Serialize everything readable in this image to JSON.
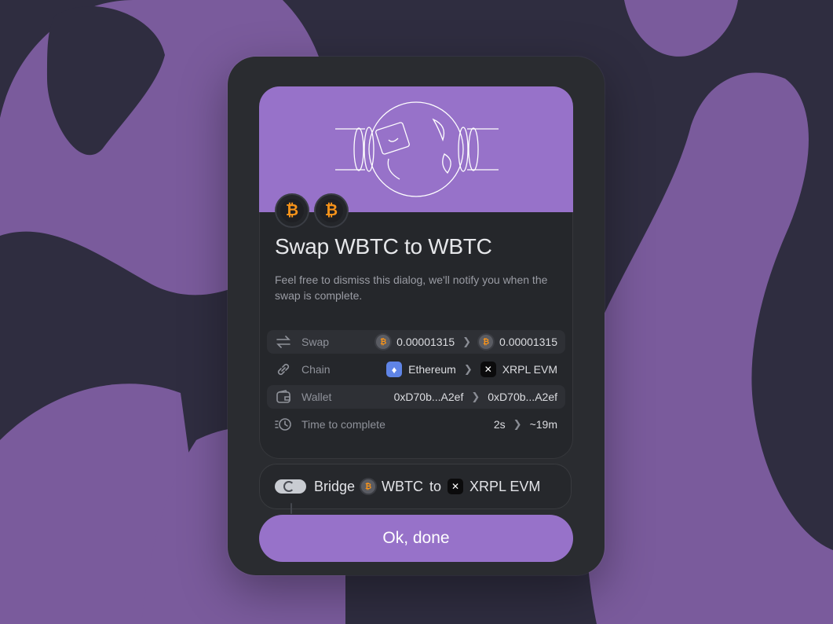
{
  "colors": {
    "background": "#2f2d40",
    "blob": "#7a5b9c",
    "accent": "#9772c9",
    "dialog": "#2a2c30"
  },
  "dialog": {
    "title": "Swap WBTC to WBTC",
    "subtitle": "Feel free to dismiss this dialog, we'll notify you when the swap is complete.",
    "token_from_icon": "bitcoin-icon",
    "token_to_icon": "bitcoin-icon"
  },
  "details": {
    "swap": {
      "label": "Swap",
      "from": "0.00001315",
      "to": "0.00001315",
      "icon": "swap-arrows-icon"
    },
    "chain": {
      "label": "Chain",
      "from": "Ethereum",
      "to": "XRPL EVM",
      "icon": "link-icon"
    },
    "wallet": {
      "label": "Wallet",
      "from": "0xD70b...A2ef",
      "to": "0xD70b...A2ef",
      "icon": "wallet-icon"
    },
    "time": {
      "label": "Time to complete",
      "from": "2s",
      "to": "~19m",
      "icon": "clock-icon"
    },
    "separator": "❯"
  },
  "step": {
    "prefix": "Bridge",
    "token": "WBTC",
    "middle": "to",
    "chain": "XRPL EVM"
  },
  "button": {
    "label": "Ok, done"
  }
}
